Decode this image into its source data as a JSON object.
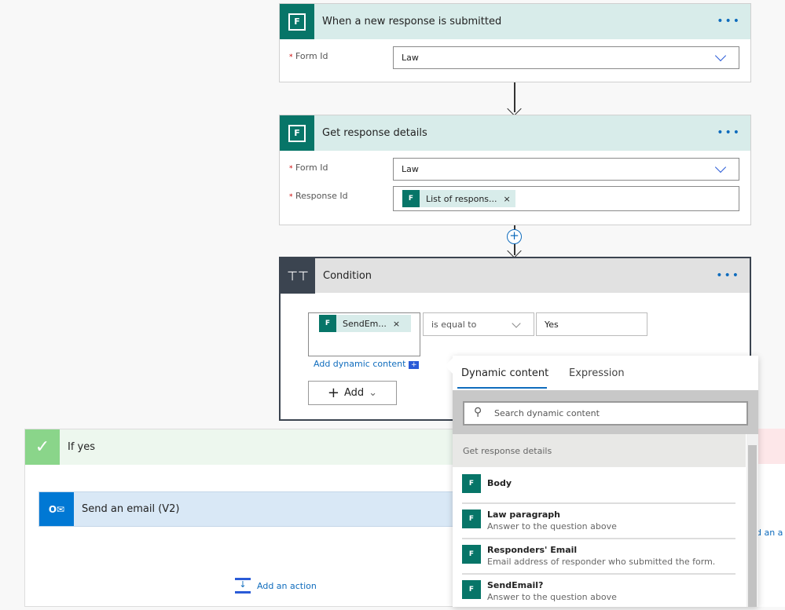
{
  "trigger": {
    "title": "When a new response is submitted",
    "form_id_label": "Form Id",
    "form_id_value": "Law",
    "required": "*"
  },
  "get_details": {
    "title": "Get response details",
    "form_id_label": "Form Id",
    "form_id_value": "Law",
    "response_id_label": "Response Id",
    "response_token": "List of respons...",
    "required": "*"
  },
  "condition": {
    "title": "Condition",
    "left_token": "SendEm...",
    "operator": "is equal to",
    "value": "Yes",
    "add_dynamic": "Add dynamic content",
    "add_button": "Add"
  },
  "if_yes": {
    "title": "If yes",
    "action_title": "Send an email (V2)",
    "add_action": "Add an action"
  },
  "if_no": {
    "add_action_partial": "dd an a"
  },
  "dynamic_panel": {
    "tabs": [
      "Dynamic content",
      "Expression"
    ],
    "active_tab": "Dynamic content",
    "search_placeholder": "Search dynamic content",
    "section": "Get response details",
    "items": [
      {
        "title": "Body",
        "desc": ""
      },
      {
        "title": "Law paragraph",
        "desc": "Answer to the question above"
      },
      {
        "title": "Responders' Email",
        "desc": "Email address of responder who submitted the form."
      },
      {
        "title": "SendEmail?",
        "desc": "Answer to the question above"
      }
    ]
  },
  "colors": {
    "forms_teal": "#077568",
    "outlook_blue": "#0078d4",
    "link_blue": "#0f6cbd",
    "yes_green": "#8ad58a",
    "condition_dark": "#3b4450"
  }
}
